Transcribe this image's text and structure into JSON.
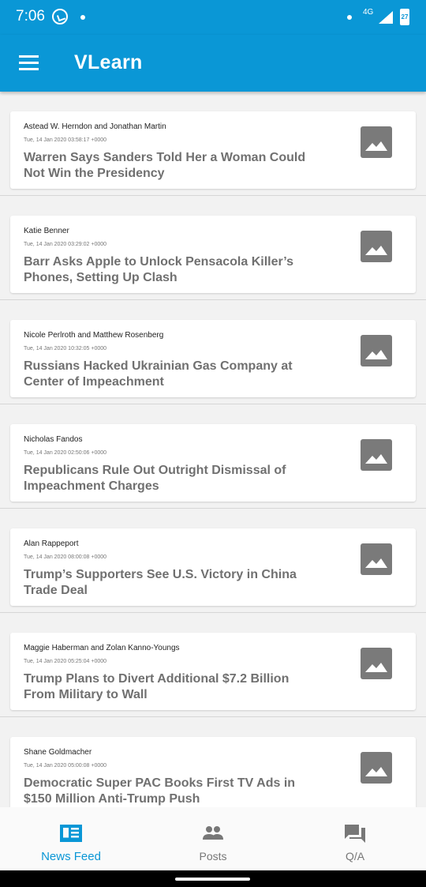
{
  "status": {
    "time": "7:06",
    "network": "4G",
    "battery": "27"
  },
  "app": {
    "title": "VLearn"
  },
  "feed": [
    {
      "author": "Astead W. Herndon and Jonathan Martin",
      "date": "Tue, 14 Jan 2020 03:58:17 +0000",
      "title": "Warren Says Sanders Told Her a Woman Could Not Win the Presidency"
    },
    {
      "author": "Katie Benner",
      "date": "Tue, 14 Jan 2020 03:29:02 +0000",
      "title": "Barr Asks Apple to Unlock Pensacola Killer’s Phones, Setting Up Clash"
    },
    {
      "author": "Nicole Perlroth and Matthew Rosenberg",
      "date": "Tue, 14 Jan 2020 10:32:05 +0000",
      "title": "Russians Hacked Ukrainian Gas Company at Center of Impeachment"
    },
    {
      "author": "Nicholas Fandos",
      "date": "Tue, 14 Jan 2020 02:50:06 +0000",
      "title": "Republicans Rule Out Outright Dismissal of Impeachment Charges"
    },
    {
      "author": "Alan Rappeport",
      "date": "Tue, 14 Jan 2020 08:00:08 +0000",
      "title": "Trump’s Supporters See U.S. Victory in China Trade Deal"
    },
    {
      "author": "Maggie Haberman and Zolan Kanno-Youngs",
      "date": "Tue, 14 Jan 2020 05:25:04 +0000",
      "title": "Trump Plans to Divert Additional $7.2 Billion From Military to Wall"
    },
    {
      "author": "Shane Goldmacher",
      "date": "Tue, 14 Jan 2020 05:00:08 +0000",
      "title": "Democratic Super PAC Books First TV Ads in $150 Million Anti-Trump Push"
    }
  ],
  "bottom_nav": [
    {
      "label": "News Feed",
      "icon": "news-feed-icon",
      "active": true
    },
    {
      "label": "Posts",
      "icon": "people-icon",
      "active": false
    },
    {
      "label": "Q/A",
      "icon": "chat-icon",
      "active": false
    }
  ],
  "colors": {
    "primary": "#0a97d6",
    "text_secondary": "#707070",
    "icon_gray": "#7a7a7a"
  }
}
